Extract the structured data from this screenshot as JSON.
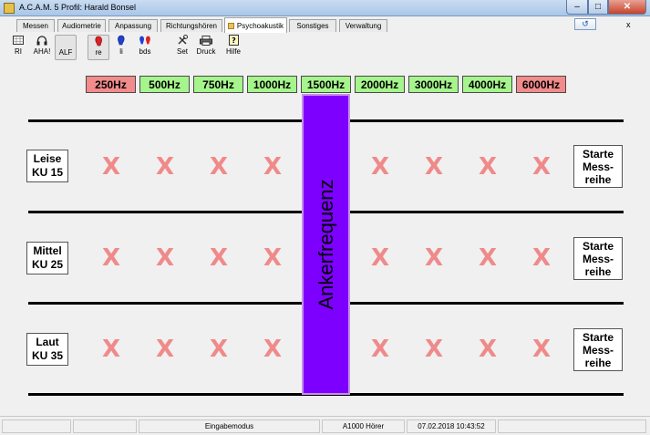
{
  "window": {
    "title": "A.C.A.M. 5  Profil: Harald Bonsel"
  },
  "tabs": [
    {
      "label": "Messen"
    },
    {
      "label": "Audiometrie"
    },
    {
      "label": "Anpassung"
    },
    {
      "label": "Richtungshören"
    },
    {
      "label": "Psychoakustik",
      "active": true
    },
    {
      "label": "Sonstiges"
    },
    {
      "label": "Verwaltung"
    }
  ],
  "tab_close": "x",
  "toolbar": [
    {
      "label": "RI",
      "icon": "audiogram-icon"
    },
    {
      "label": "AHA!",
      "icon": "headphones-icon"
    },
    {
      "label": "ALF",
      "icon": "blank-icon",
      "pressed": true
    },
    {
      "label": "re",
      "icon": "right-ear-icon",
      "pressed": true
    },
    {
      "label": "li",
      "icon": "left-ear-icon"
    },
    {
      "label": "bds",
      "icon": "both-ears-icon"
    },
    {
      "label": "Set",
      "icon": "tools-icon"
    },
    {
      "label": "Druck",
      "icon": "printer-icon"
    },
    {
      "label": "Hilfe",
      "icon": "help-icon"
    }
  ],
  "frequencies": [
    {
      "label": "250Hz",
      "active": false
    },
    {
      "label": "500Hz",
      "active": true
    },
    {
      "label": "750Hz",
      "active": true
    },
    {
      "label": "1000Hz",
      "active": true
    },
    {
      "label": "1500Hz",
      "active": true
    },
    {
      "label": "2000Hz",
      "active": true
    },
    {
      "label": "3000Hz",
      "active": true
    },
    {
      "label": "4000Hz",
      "active": true
    },
    {
      "label": "6000Hz",
      "active": false
    }
  ],
  "anchor_label": "Ankerfrequenz",
  "mark_symbol": "X",
  "levels": [
    {
      "line1": "Leise",
      "line2": "KU 15"
    },
    {
      "line1": "Mittel",
      "line2": "KU 25"
    },
    {
      "line1": "Laut",
      "line2": "KU 35"
    }
  ],
  "start_button": {
    "line1": "Starte",
    "line2": "Mess-",
    "line3": "reihe"
  },
  "statusbar": [
    "",
    "",
    "Eingabemodus",
    "A1000 Hörer",
    "07.02.2018 10:43:52",
    ""
  ],
  "colors": {
    "active_freq": "#a6f58c",
    "inactive_freq": "#f28b8b",
    "anchor": "#7d00ff",
    "mark": "#f08a8a"
  }
}
